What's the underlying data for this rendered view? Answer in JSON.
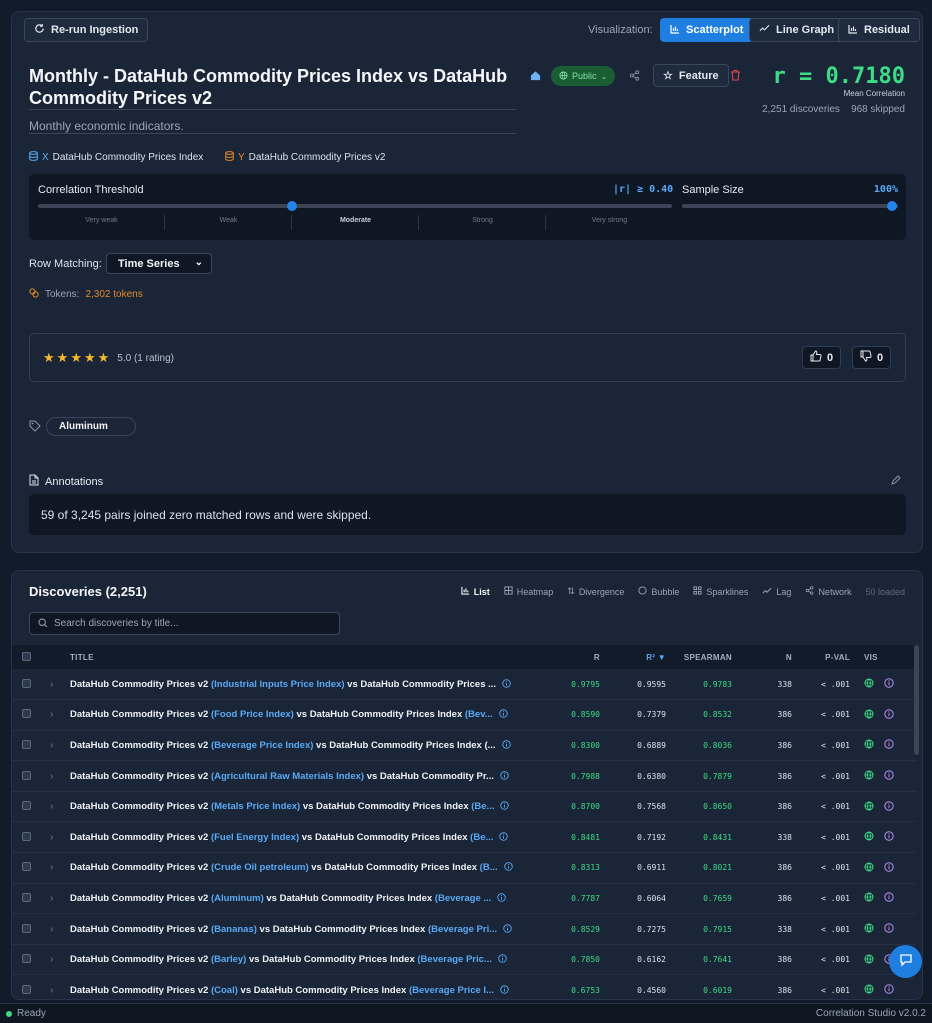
{
  "toolbar": {
    "rerun_label": "Re-run Ingestion",
    "viz_label": "Visualization:",
    "viz_options": [
      "Scatterplot",
      "Line Graph",
      "Residual"
    ],
    "viz_active": "Scatterplot"
  },
  "header": {
    "title": "Monthly - DataHub Commodity Prices Index vs DataHub Commodity Prices v2",
    "subtitle": "Monthly economic indicators.",
    "visibility": "Public",
    "feature_label": "Feature",
    "r_value": "r = 0.7180",
    "r_caption": "Mean Correlation",
    "discoveries": "2,251 discoveries",
    "skipped": "968 skipped"
  },
  "axes": {
    "x_prefix": "X",
    "x_label": "DataHub Commodity Prices Index",
    "y_prefix": "Y",
    "y_label": "DataHub Commodity Prices v2"
  },
  "threshold": {
    "label": "Correlation Threshold",
    "value_text": "|r| ≥ 0.40",
    "value": 0.4,
    "sample_label": "Sample Size",
    "sample_text": "100%",
    "sample_value": 1.0,
    "segments": [
      "Very weak",
      "Weak",
      "Moderate",
      "Strong",
      "Very strong"
    ],
    "active_segment": "Moderate"
  },
  "row_matching": {
    "label": "Row Matching:",
    "selected": "Time Series"
  },
  "tokens": {
    "label": "Tokens:",
    "value": "2,302 tokens"
  },
  "rating": {
    "stars": 5,
    "text": "5.0 (1 rating)",
    "up": "0",
    "down": "0"
  },
  "tags": [
    "Aluminum"
  ],
  "annotations": {
    "label": "Annotations",
    "text": "59 of 3,245 pairs joined zero matched rows and were skipped."
  },
  "discoveries": {
    "title": "Discoveries (2,251)",
    "views": [
      "List",
      "Heatmap",
      "Divergence",
      "Bubble",
      "Sparklines",
      "Lag",
      "Network"
    ],
    "active_view": "List",
    "loaded": "50 loaded",
    "search_placeholder": "Search discoveries by title...",
    "columns": [
      "TITLE",
      "R",
      "R² ▼",
      "SPEARMAN",
      "N",
      "P-VAL",
      "VIS"
    ],
    "rows": [
      {
        "prefix": "DataHub Commodity Prices v2 ",
        "hl1": "(Industrial Inputs Price Index)",
        "mid": " vs DataHub Commodity Prices ...",
        "hl2": "",
        "r": "0.9795",
        "r2": "0.9595",
        "sp": "0.9783",
        "n": "338",
        "p": "< .001"
      },
      {
        "prefix": "DataHub Commodity Prices v2 ",
        "hl1": "(Food Price Index)",
        "mid": " vs DataHub Commodity Prices Index ",
        "hl2": "(Bev...",
        "r": "0.8590",
        "r2": "0.7379",
        "sp": "0.8532",
        "n": "386",
        "p": "< .001"
      },
      {
        "prefix": "DataHub Commodity Prices v2 ",
        "hl1": "(Beverage Price Index)",
        "mid": " vs DataHub Commodity Prices Index (...",
        "hl2": "",
        "r": "0.8300",
        "r2": "0.6889",
        "sp": "0.8036",
        "n": "386",
        "p": "< .001"
      },
      {
        "prefix": "DataHub Commodity Prices v2 ",
        "hl1": "(Agricultural Raw Materials Index)",
        "mid": " vs DataHub Commodity Pr...",
        "hl2": "",
        "r": "0.7988",
        "r2": "0.6380",
        "sp": "0.7879",
        "n": "386",
        "p": "< .001"
      },
      {
        "prefix": "DataHub Commodity Prices v2 ",
        "hl1": "(Metals Price Index)",
        "mid": " vs DataHub Commodity Prices Index ",
        "hl2": "(Be...",
        "r": "0.8700",
        "r2": "0.7568",
        "sp": "0.8650",
        "n": "386",
        "p": "< .001"
      },
      {
        "prefix": "DataHub Commodity Prices v2 ",
        "hl1": "(Fuel Energy Index)",
        "mid": " vs DataHub Commodity Prices Index ",
        "hl2": "(Be...",
        "r": "0.8481",
        "r2": "0.7192",
        "sp": "0.8431",
        "n": "338",
        "p": "< .001"
      },
      {
        "prefix": "DataHub Commodity Prices v2 ",
        "hl1": "(Crude Oil petroleum)",
        "mid": " vs DataHub Commodity Prices Index ",
        "hl2": "(B...",
        "r": "0.8313",
        "r2": "0.6911",
        "sp": "0.8021",
        "n": "386",
        "p": "< .001"
      },
      {
        "prefix": "DataHub Commodity Prices v2 ",
        "hl1": "(Aluminum)",
        "mid": " vs DataHub Commodity Prices Index ",
        "hl2": "(Beverage ...",
        "r": "0.7787",
        "r2": "0.6064",
        "sp": "0.7659",
        "n": "386",
        "p": "< .001"
      },
      {
        "prefix": "DataHub Commodity Prices v2 ",
        "hl1": "(Bananas)",
        "mid": " vs DataHub Commodity Prices Index ",
        "hl2": "(Beverage Pri...",
        "r": "0.8529",
        "r2": "0.7275",
        "sp": "0.7915",
        "n": "338",
        "p": "< .001"
      },
      {
        "prefix": "DataHub Commodity Prices v2 ",
        "hl1": "(Barley)",
        "mid": " vs DataHub Commodity Prices Index ",
        "hl2": "(Beverage Pric...",
        "r": "0.7850",
        "r2": "0.6162",
        "sp": "0.7641",
        "n": "386",
        "p": "< .001"
      },
      {
        "prefix": "DataHub Commodity Prices v2 ",
        "hl1": "(Coal)",
        "mid": " vs DataHub Commodity Prices Index ",
        "hl2": "(Beverage Price I...",
        "r": "0.6753",
        "r2": "0.4560",
        "sp": "0.6019",
        "n": "386",
        "p": "< .001"
      }
    ]
  },
  "status": {
    "left": "Ready",
    "right": "Correlation Studio v2.0.2"
  },
  "colors": {
    "accent": "#1f7fe0",
    "positive": "#3ddc84",
    "highlight": "#5aa9f5",
    "tokens": "#e0892a",
    "star": "#f5b92e"
  }
}
